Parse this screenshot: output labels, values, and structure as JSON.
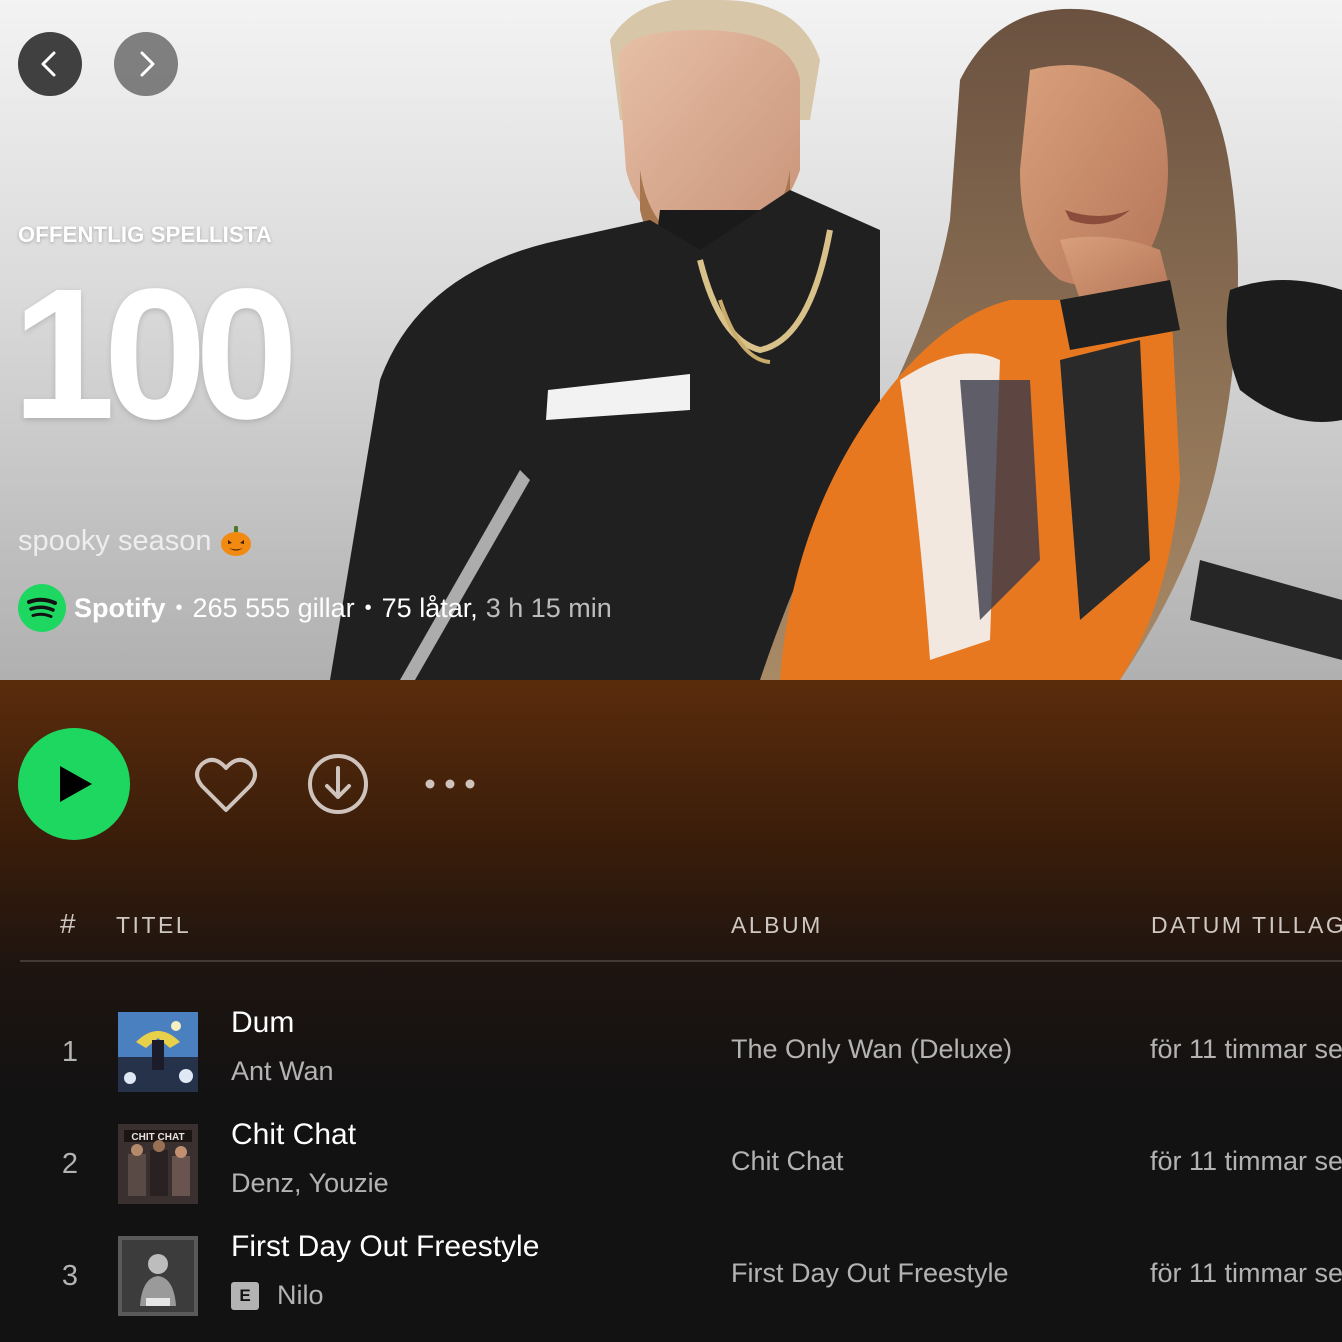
{
  "header": {
    "type_label": "OFFENTLIG SPELLISTA",
    "title": "100",
    "description": "spooky season",
    "owner": "Spotify",
    "likes": "265 555 gillar",
    "track_count": "75 låtar,",
    "duration": "3 h 15 min"
  },
  "table": {
    "headers": {
      "number": "#",
      "title": "TITEL",
      "album": "ALBUM",
      "date_added": "DATUM TILLAG"
    },
    "rows": [
      {
        "number": "1",
        "title": "Dum",
        "artist": "Ant Wan",
        "explicit": "",
        "album": "The Only Wan (Deluxe)",
        "added": "för 11 timmar se"
      },
      {
        "number": "2",
        "title": "Chit Chat",
        "artist": "Denz, Youzie",
        "explicit": "",
        "album": "Chit Chat",
        "added": "för 11 timmar se"
      },
      {
        "number": "3",
        "title": "First Day Out Freestyle",
        "artist": "Nilo",
        "explicit": "E",
        "album": "First Day Out Freestyle",
        "added": "för 11 timmar se"
      }
    ]
  },
  "colors": {
    "accent": "#1ed760",
    "background": "#121212",
    "header_tint": "#5a2c0c"
  },
  "icons": [
    "chevron-left-icon",
    "chevron-right-icon",
    "pumpkin-icon",
    "spotify-logo-icon",
    "play-icon",
    "heart-icon",
    "download-icon",
    "more-icon"
  ]
}
